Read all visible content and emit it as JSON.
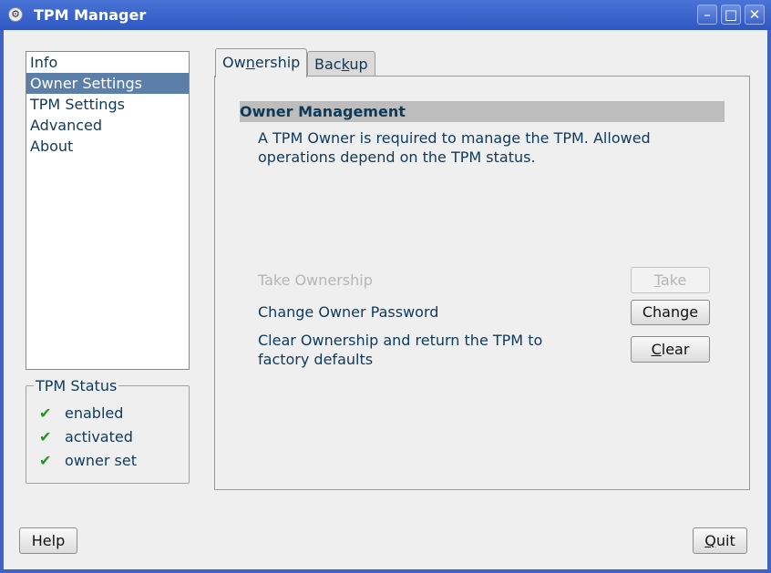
{
  "window": {
    "title": "TPM Manager"
  },
  "nav": {
    "items": [
      "Info",
      "Owner Settings",
      "TPM Settings",
      "Advanced",
      "About"
    ],
    "selected_index": 1
  },
  "status": {
    "title": "TPM Status",
    "items": [
      "enabled",
      "activated",
      "owner set"
    ]
  },
  "tabs": [
    {
      "label": "Ownership",
      "prefix": "Ow",
      "accel": "n",
      "suffix": "ership",
      "active": true
    },
    {
      "label": "Backup",
      "prefix": "Bac",
      "accel": "k",
      "suffix": "up",
      "active": false
    }
  ],
  "owner": {
    "header": "Owner Management",
    "description": "A TPM Owner is required to manage the TPM. Allowed operations depend on the TPM status.",
    "ops": [
      {
        "label": "Take Ownership",
        "button": "Take",
        "accel": "T",
        "rest": "ake",
        "enabled": false
      },
      {
        "label": "Change Owner Password",
        "button": "Change",
        "accel": "",
        "rest": "Change",
        "enabled": true
      },
      {
        "label": "Clear Ownership and return the TPM to factory defaults",
        "button": "Clear",
        "accel": "C",
        "rest": "lear",
        "enabled": true
      }
    ]
  },
  "footer": {
    "help": "Help",
    "quit": "Quit",
    "quit_accel": "Q",
    "quit_rest": "uit"
  },
  "colors": {
    "titlebar": "#3e63c6",
    "selection": "#5b7fa9",
    "section_header": "#bdbdbd",
    "check": "#1a9a1a"
  }
}
